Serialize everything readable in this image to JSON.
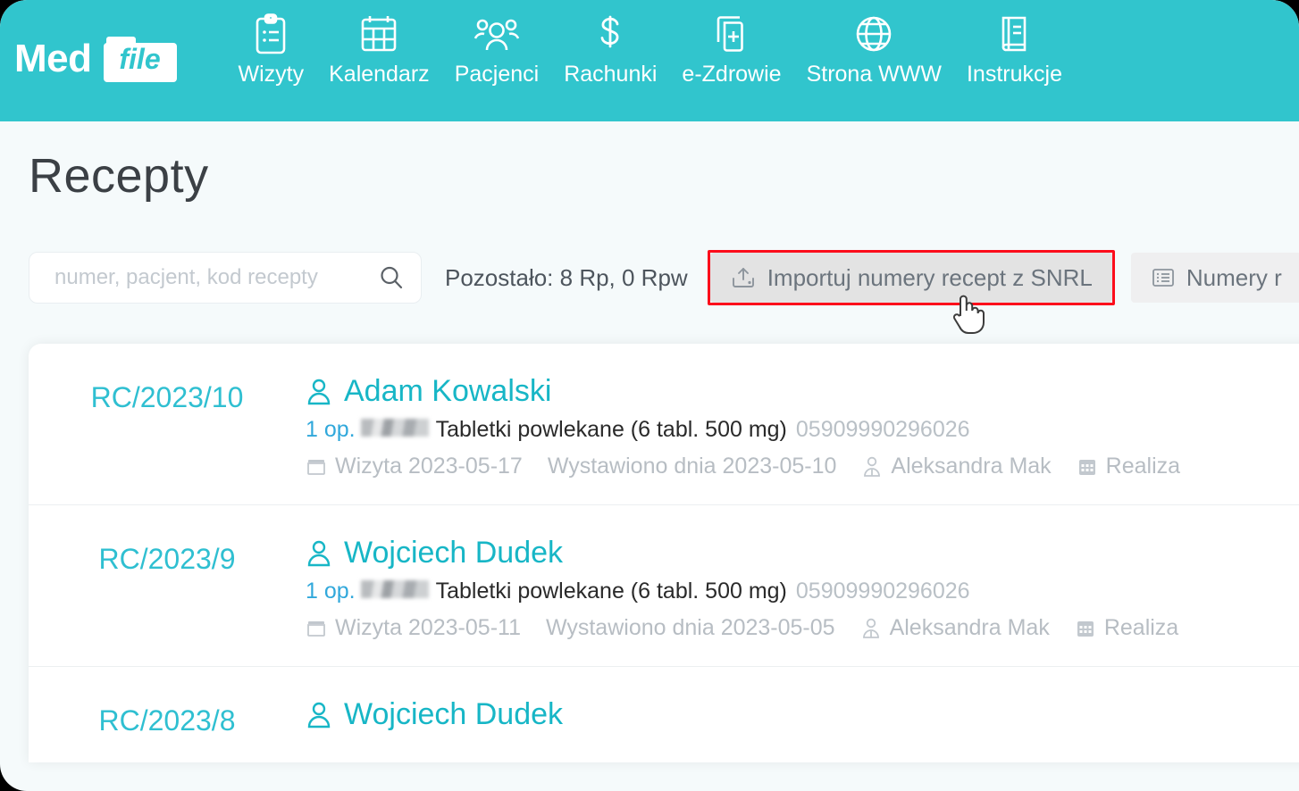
{
  "brand": {
    "word1": "Med",
    "word2": "file"
  },
  "nav": {
    "items": [
      {
        "label": "Wizyty",
        "icon": "clipboard-icon"
      },
      {
        "label": "Kalendarz",
        "icon": "calendar-icon"
      },
      {
        "label": "Pacjenci",
        "icon": "people-icon"
      },
      {
        "label": "Rachunki",
        "icon": "dollar-icon"
      },
      {
        "label": "e-Zdrowie",
        "icon": "medical-docs-icon"
      },
      {
        "label": "Strona WWW",
        "icon": "globe-icon"
      },
      {
        "label": "Instrukcje",
        "icon": "book-icon"
      }
    ]
  },
  "page": {
    "title": "Recepty"
  },
  "search": {
    "placeholder": "numer, pacjent, kod recepty",
    "value": ""
  },
  "toolbar": {
    "remaining_label": "Pozostało: 8 Rp, 0 Rpw",
    "import_button": "Importuj numery recept z SNRL",
    "numbers_button": "Numery r",
    "highlight_color": "#fc0d1b"
  },
  "colors": {
    "brand_teal": "#31c5cd",
    "link_teal": "#17b6c6",
    "code_teal": "#2fbfd1",
    "page_bg": "#f5fafb",
    "muted": "#b7bdc3"
  },
  "list": {
    "rows": [
      {
        "code": "RC/2023/10",
        "patient": "Adam Kowalski",
        "qty": "1 op.",
        "drug": "Tabletki powlekane (6 tabl. 500 mg)",
        "ean": "05909990296026",
        "visit": "Wizyta 2023-05-17",
        "issued": "Wystawiono dnia 2023-05-10",
        "doctor": "Aleksandra Mak",
        "realization": "Realiza"
      },
      {
        "code": "RC/2023/9",
        "patient": "Wojciech Dudek",
        "qty": "1 op.",
        "drug": "Tabletki powlekane (6 tabl. 500 mg)",
        "ean": "05909990296026",
        "visit": "Wizyta 2023-05-11",
        "issued": "Wystawiono dnia 2023-05-05",
        "doctor": "Aleksandra Mak",
        "realization": "Realiza"
      },
      {
        "code": "RC/2023/8",
        "patient": "Wojciech Dudek",
        "qty": "",
        "drug": "",
        "ean": "",
        "visit": "",
        "issued": "",
        "doctor": "",
        "realization": ""
      }
    ]
  }
}
